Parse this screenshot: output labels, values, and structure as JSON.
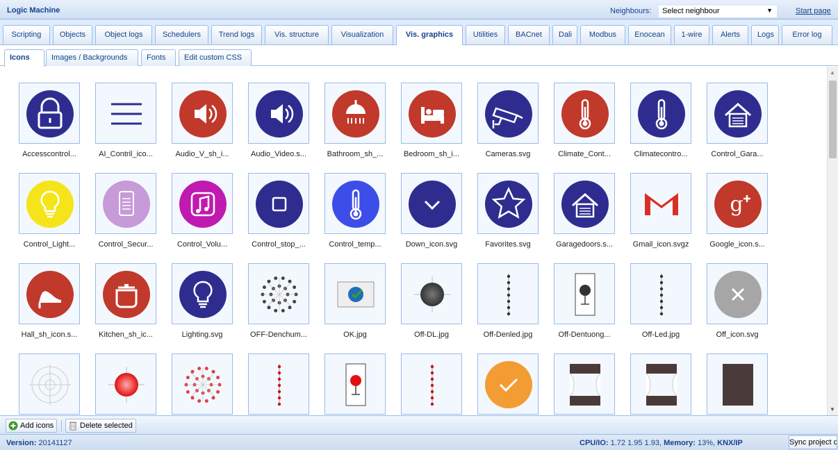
{
  "app": {
    "title": "Logic Machine"
  },
  "neighbours": {
    "label": "Neighbours:",
    "selected": "Select neighbour",
    "start_page": "Start page"
  },
  "main_tabs": [
    {
      "label": "Scripting"
    },
    {
      "label": "Objects"
    },
    {
      "label": "Object logs"
    },
    {
      "label": "Schedulers"
    },
    {
      "label": "Trend logs"
    },
    {
      "label": "Vis. structure"
    },
    {
      "label": "Visualization"
    },
    {
      "label": "Vis. graphics",
      "active": true
    },
    {
      "label": "Utilities"
    },
    {
      "label": "BACnet"
    },
    {
      "label": "Dali"
    },
    {
      "label": "Modbus"
    },
    {
      "label": "Enocean"
    },
    {
      "label": "1-wire"
    },
    {
      "label": "Alerts"
    },
    {
      "label": "Logs"
    },
    {
      "label": "Error log"
    }
  ],
  "sub_tabs": [
    {
      "label": "Icons",
      "active": true
    },
    {
      "label": "Images / Backgrounds"
    },
    {
      "label": "Fonts"
    },
    {
      "label": "Edit custom CSS"
    }
  ],
  "icons": [
    {
      "name": "Accesscontrol...",
      "icon": "lock-icon",
      "color": "#2e2d8f"
    },
    {
      "name": "AI_Contril_ico...",
      "icon": "menu-lines-icon",
      "color": "#2e2d8f"
    },
    {
      "name": "Audio_V_sh_i...",
      "icon": "speaker-icon",
      "color": "#c0392b"
    },
    {
      "name": "Audio_Video.s...",
      "icon": "speaker-icon",
      "color": "#2e2d8f"
    },
    {
      "name": "Bathroom_sh_...",
      "icon": "shower-icon",
      "color": "#c0392b"
    },
    {
      "name": "Bedroom_sh_i...",
      "icon": "bed-icon",
      "color": "#c0392b"
    },
    {
      "name": "Cameras.svg",
      "icon": "camera-icon",
      "color": "#2e2d8f"
    },
    {
      "name": "Climate_Cont...",
      "icon": "thermometer-icon",
      "color": "#c0392b"
    },
    {
      "name": "Climatecontro...",
      "icon": "thermometer-icon",
      "color": "#2e2d8f"
    },
    {
      "name": "Control_Gara...",
      "icon": "garage-icon",
      "color": "#2e2d8f"
    },
    {
      "name": "Control_Light...",
      "icon": "bulb-icon",
      "color": "#f5e41a"
    },
    {
      "name": "Control_Secur...",
      "icon": "keypad-icon",
      "color": "#c79ad8"
    },
    {
      "name": "Control_Volu...",
      "icon": "music-icon",
      "color": "#c01ab0"
    },
    {
      "name": "Control_stop_...",
      "icon": "stop-icon",
      "color": "#2e2d8f"
    },
    {
      "name": "Control_temp...",
      "icon": "thermometer-icon",
      "color": "#3d4ee8"
    },
    {
      "name": "Down_icon.svg",
      "icon": "chevron-down-icon",
      "color": "#2e2d8f"
    },
    {
      "name": "Favorites.svg",
      "icon": "star-icon",
      "color": "#2e2d8f"
    },
    {
      "name": "Garagedoors.s...",
      "icon": "garage-icon",
      "color": "#2e2d8f"
    },
    {
      "name": "Gmail_icon.svgz",
      "icon": "gmail-icon",
      "color": "#d93025"
    },
    {
      "name": "Google_icon.s...",
      "icon": "google-plus-icon",
      "color": "#c0392b"
    },
    {
      "name": "Hall_sh_icon.s...",
      "icon": "shoe-icon",
      "color": "#c0392b"
    },
    {
      "name": "Kitchen_sh_ic...",
      "icon": "pot-icon",
      "color": "#c0392b"
    },
    {
      "name": "Lighting.svg",
      "icon": "bulb-icon",
      "color": "#2e2d8f"
    },
    {
      "name": "OFF-Denchum...",
      "icon": "dot-ring-icon",
      "color": "#444444"
    },
    {
      "name": "OK.jpg",
      "icon": "ok-globe-icon",
      "color": "#1f6db5"
    },
    {
      "name": "Off-DL.jpg",
      "icon": "downlight-icon",
      "color": "#333333"
    },
    {
      "name": "Off-Denled.jpg",
      "icon": "led-strip-icon",
      "color": "#333333"
    },
    {
      "name": "Off-Dentuong...",
      "icon": "wall-lamp-icon",
      "color": "#333333"
    },
    {
      "name": "Off-Led.jpg",
      "icon": "led-strip-icon",
      "color": "#333333"
    },
    {
      "name": "Off_icon.svg",
      "icon": "close-circle-icon",
      "color": "#a6a6a6"
    },
    {
      "name": "",
      "icon": "ring-grid-icon",
      "color": "#cccccc"
    },
    {
      "name": "",
      "icon": "downlight-icon",
      "color": "#e01010"
    },
    {
      "name": "",
      "icon": "dot-ring-icon",
      "color": "#e04040"
    },
    {
      "name": "",
      "icon": "led-strip-icon",
      "color": "#d01010"
    },
    {
      "name": "",
      "icon": "wall-lamp-icon",
      "color": "#e01010"
    },
    {
      "name": "",
      "icon": "led-strip-icon",
      "color": "#d01010"
    },
    {
      "name": "",
      "icon": "check-circle-icon",
      "color": "#f39c33"
    },
    {
      "name": "",
      "icon": "curtain-icon",
      "color": "#4a3a3a"
    },
    {
      "name": "",
      "icon": "curtain-icon",
      "color": "#4a3a3a"
    },
    {
      "name": "",
      "icon": "curtain-closed-icon",
      "color": "#4a3a3a"
    }
  ],
  "toolbar": {
    "add_label": "Add icons",
    "delete_label": "Delete selected"
  },
  "status": {
    "version_label": "Version:",
    "version": "20141127",
    "cpu_label": "CPU/IO:",
    "cpu": "1.72 1.95 1.93,",
    "mem_label": "Memory:",
    "mem": "13%,",
    "knx_label": "KNX/IP",
    "sync_label": "Sync project data"
  }
}
